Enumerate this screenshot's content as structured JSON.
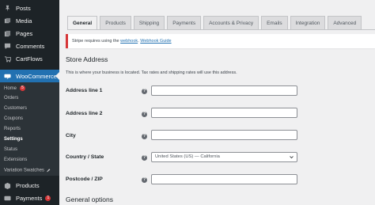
{
  "sidebar": {
    "items": [
      {
        "label": "Posts",
        "icon": "pin-icon"
      },
      {
        "label": "Media",
        "icon": "media-icon"
      },
      {
        "label": "Pages",
        "icon": "pages-icon"
      },
      {
        "label": "Comments",
        "icon": "comments-icon"
      },
      {
        "label": "CartFlows",
        "icon": "cartflows-icon"
      },
      {
        "label": "WooCommerce",
        "icon": "woocommerce-icon"
      }
    ],
    "submenu": [
      {
        "label": "Home",
        "badge": "5"
      },
      {
        "label": "Orders"
      },
      {
        "label": "Customers"
      },
      {
        "label": "Coupons"
      },
      {
        "label": "Reports"
      },
      {
        "label": "Settings"
      },
      {
        "label": "Status"
      },
      {
        "label": "Extensions"
      },
      {
        "label": "Variation Swatches"
      }
    ],
    "bottom": [
      {
        "label": "Products",
        "icon": "products-icon"
      },
      {
        "label": "Payments",
        "icon": "payments-icon",
        "badge": "1"
      }
    ]
  },
  "tabs": [
    "General",
    "Products",
    "Shipping",
    "Payments",
    "Accounts & Privacy",
    "Emails",
    "Integration",
    "Advanced"
  ],
  "notice": {
    "prefix": "Stripe requires using the",
    "link1": "webhook",
    "sep": ".",
    "link2": "Webhook Guide"
  },
  "store_address": {
    "title": "Store Address",
    "description": "This is where your business is located. Tax rates and shipping rates will use this address."
  },
  "fields": [
    {
      "label": "Address line 1",
      "value": ""
    },
    {
      "label": "Address line 2",
      "value": ""
    },
    {
      "label": "City",
      "value": ""
    },
    {
      "label": "Country / State",
      "value": "United States (US) — California"
    },
    {
      "label": "Postcode / ZIP",
      "value": ""
    }
  ],
  "general_options": {
    "title": "General options"
  },
  "colors": {
    "sidebar": "#1d2327",
    "accent": "#2271b1",
    "error": "#d63638"
  }
}
